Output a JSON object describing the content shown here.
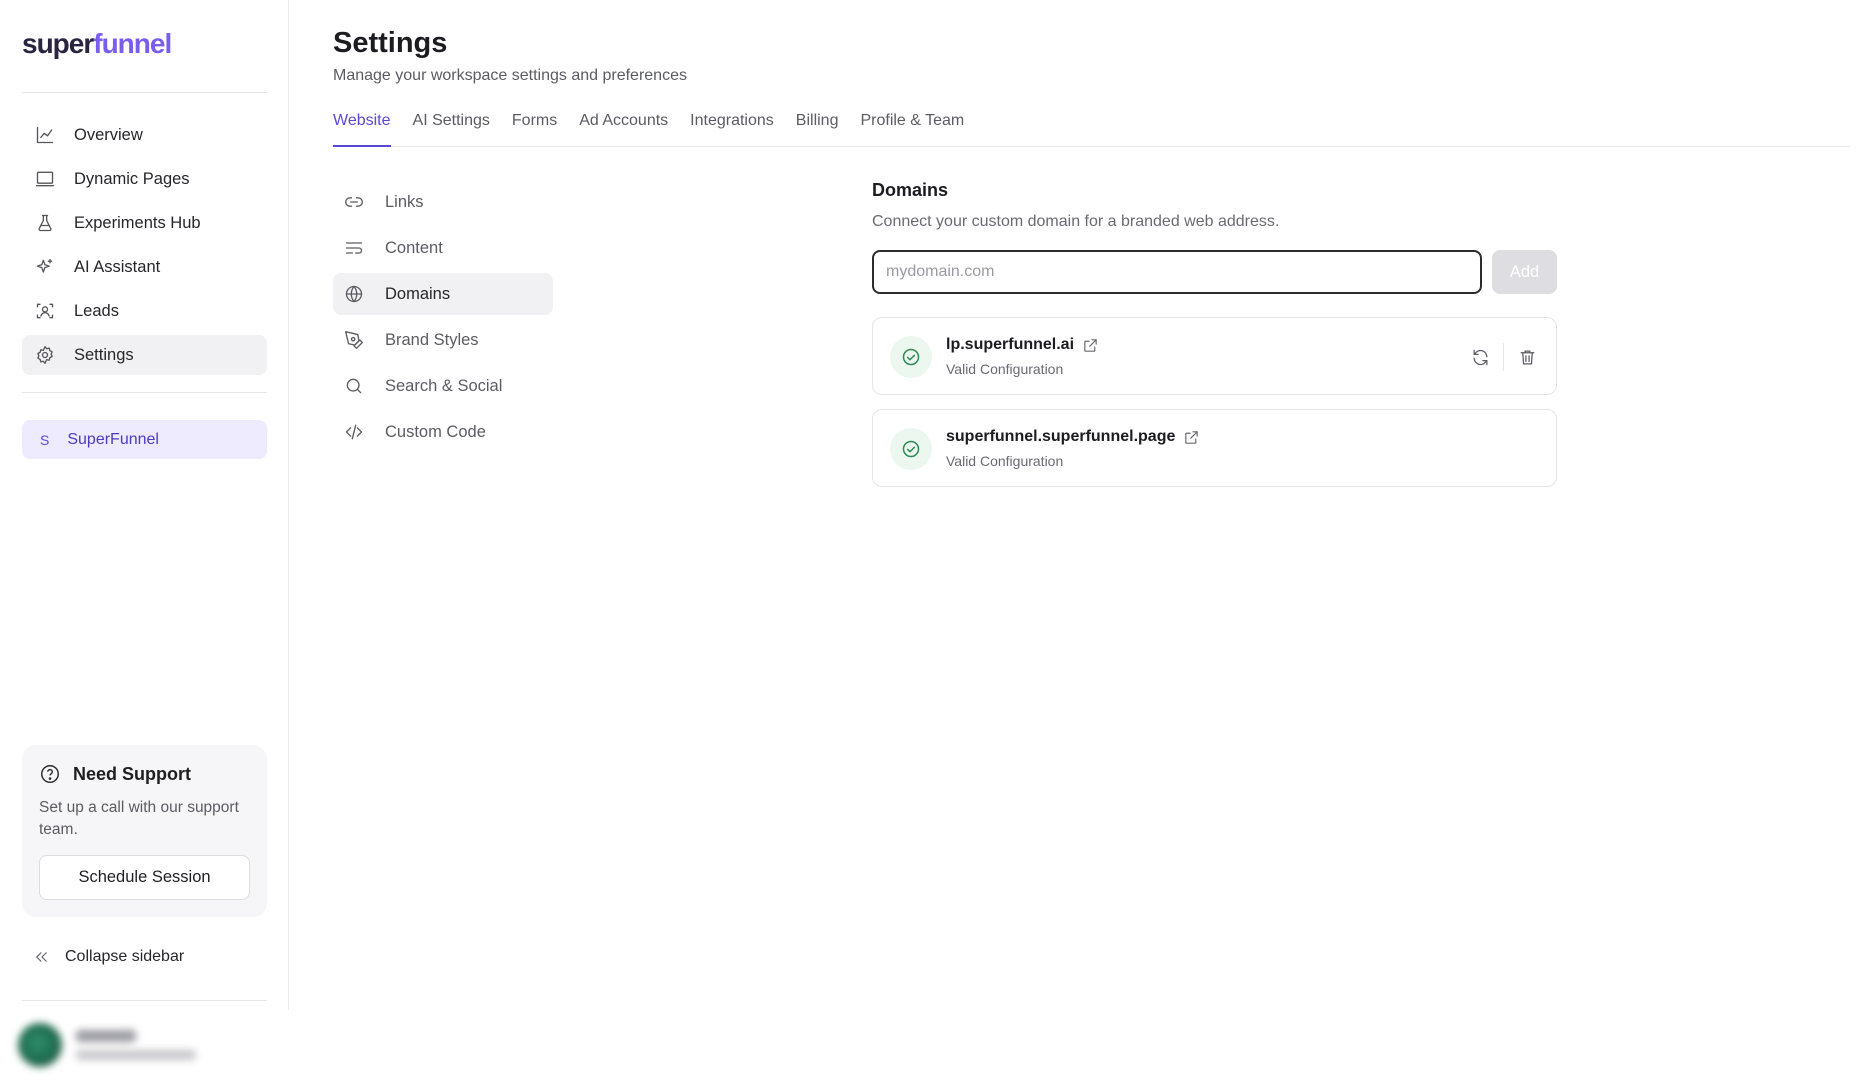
{
  "brand": {
    "logo_part1": "super",
    "logo_part2": "funnel"
  },
  "sidebar": {
    "items": [
      {
        "label": "Overview",
        "icon": "chart-line-icon"
      },
      {
        "label": "Dynamic Pages",
        "icon": "monitor-icon"
      },
      {
        "label": "Experiments Hub",
        "icon": "flask-icon"
      },
      {
        "label": "AI Assistant",
        "icon": "sparkles-icon"
      },
      {
        "label": "Leads",
        "icon": "user-scan-icon"
      },
      {
        "label": "Settings",
        "icon": "gear-icon",
        "active": true
      }
    ],
    "workspace": {
      "letter": "S",
      "name": "SuperFunnel"
    },
    "support": {
      "title": "Need Support",
      "text": "Set up a call with our support team.",
      "button": "Schedule Session"
    },
    "collapse_label": "Collapse sidebar"
  },
  "header": {
    "title": "Settings",
    "subtitle": "Manage your workspace settings and preferences"
  },
  "tabs": [
    {
      "label": "Website",
      "active": true
    },
    {
      "label": "AI Settings"
    },
    {
      "label": "Forms"
    },
    {
      "label": "Ad Accounts"
    },
    {
      "label": "Integrations"
    },
    {
      "label": "Billing"
    },
    {
      "label": "Profile & Team"
    }
  ],
  "subnav": [
    {
      "label": "Links",
      "icon": "link-icon"
    },
    {
      "label": "Content",
      "icon": "text-lines-icon"
    },
    {
      "label": "Domains",
      "icon": "globe-icon",
      "active": true
    },
    {
      "label": "Brand Styles",
      "icon": "pen-tool-icon"
    },
    {
      "label": "Search & Social",
      "icon": "search-icon"
    },
    {
      "label": "Custom Code",
      "icon": "code-icon"
    }
  ],
  "domains": {
    "title": "Domains",
    "subtitle": "Connect your custom domain for a branded web address.",
    "input_placeholder": "mydomain.com",
    "add_label": "Add",
    "list": [
      {
        "name": "lp.superfunnel.ai",
        "status": "Valid Configuration"
      },
      {
        "name": "superfunnel.superfunnel.page",
        "status": "Valid Configuration"
      }
    ]
  },
  "colors": {
    "accent": "#5b47d6",
    "success": "#2f8a54",
    "workspace_bg": "#eeeaff"
  }
}
